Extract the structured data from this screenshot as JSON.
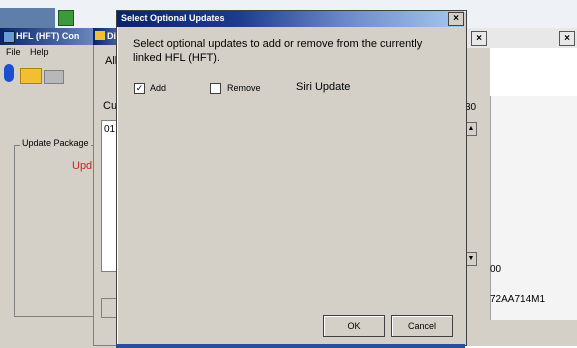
{
  "background": {
    "right_top_text": "",
    "left_window": {
      "title": "HFL (HFT) Con",
      "menu": [
        "File",
        "Help"
      ],
      "group_label": "Update Package",
      "red_text": "Upd"
    },
    "middle_window": {
      "title": "Di",
      "all_label": "All",
      "cu_label": "Cu",
      "list_first_item": "01"
    },
    "right_window": {
      "label_30": "30",
      "label_00": "00",
      "label_code": "72AA714M1"
    }
  },
  "dialog": {
    "title": "Select Optional Updates",
    "close_label": "×",
    "instruction": "Select optional updates to add or remove from the currently linked HFL (HFT).",
    "options": [
      {
        "label": "Add",
        "checked": true
      },
      {
        "label": "Remove",
        "checked": false
      }
    ],
    "update_name": "Siri Update",
    "ok_label": "OK",
    "cancel_label": "Cancel"
  },
  "colors": {
    "title_start": "#0a246a",
    "title_end": "#a6caf0",
    "window_face": "#d4d0c8",
    "alert_red": "#d02020"
  }
}
